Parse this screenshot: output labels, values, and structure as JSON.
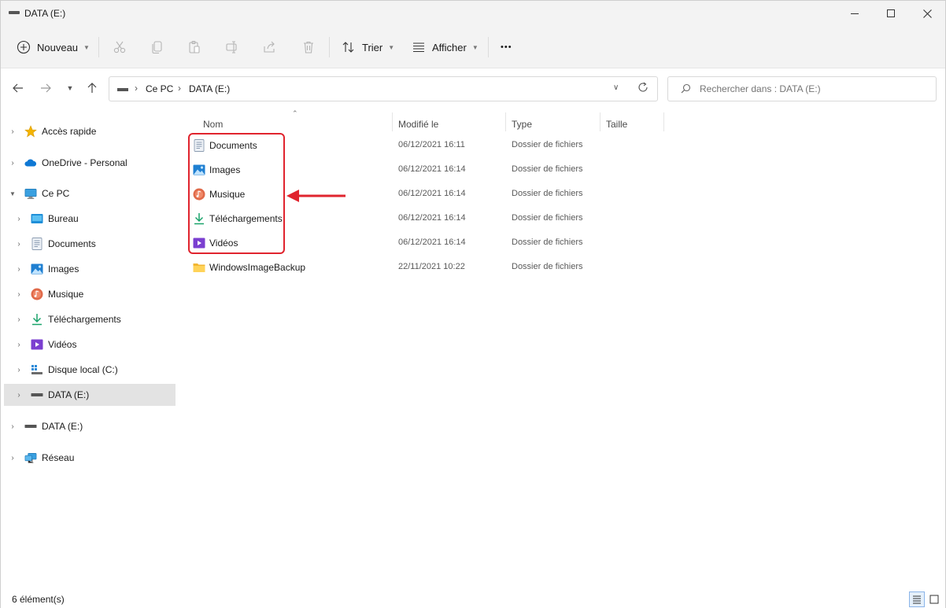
{
  "window": {
    "title": "DATA (E:)"
  },
  "toolbar": {
    "new_label": "Nouveau",
    "sort_label": "Trier",
    "view_label": "Afficher",
    "more_label": "•••"
  },
  "address": {
    "crumbs": [
      "Ce PC",
      "DATA (E:)"
    ]
  },
  "search": {
    "placeholder": "Rechercher dans : DATA (E:)"
  },
  "nav": {
    "items": [
      {
        "label": "Accès rapide",
        "icon": "star-icon"
      },
      {
        "label": "OneDrive - Personal",
        "icon": "cloud-icon"
      },
      {
        "label": "Ce PC",
        "icon": "computer-icon"
      },
      {
        "label": "Bureau",
        "icon": "desktop-icon"
      },
      {
        "label": "Documents",
        "icon": "document-icon"
      },
      {
        "label": "Images",
        "icon": "image-icon"
      },
      {
        "label": "Musique",
        "icon": "music-icon"
      },
      {
        "label": "Téléchargements",
        "icon": "download-icon"
      },
      {
        "label": "Vidéos",
        "icon": "video-icon"
      },
      {
        "label": "Disque local (C:)",
        "icon": "windows-drive-icon"
      },
      {
        "label": "DATA (E:)",
        "icon": "drive-icon"
      },
      {
        "label": "DATA (E:)",
        "icon": "drive-icon"
      },
      {
        "label": "Réseau",
        "icon": "network-icon"
      }
    ]
  },
  "columns": {
    "name": "Nom",
    "modified": "Modifié le",
    "type": "Type",
    "size": "Taille"
  },
  "files": [
    {
      "name": "Documents",
      "modified": "06/12/2021 16:11",
      "type": "Dossier de fichiers",
      "icon": "document-icon"
    },
    {
      "name": "Images",
      "modified": "06/12/2021 16:14",
      "type": "Dossier de fichiers",
      "icon": "image-icon"
    },
    {
      "name": "Musique",
      "modified": "06/12/2021 16:14",
      "type": "Dossier de fichiers",
      "icon": "music-icon"
    },
    {
      "name": "Téléchargements",
      "modified": "06/12/2021 16:14",
      "type": "Dossier de fichiers",
      "icon": "download-icon"
    },
    {
      "name": "Vidéos",
      "modified": "06/12/2021 16:14",
      "type": "Dossier de fichiers",
      "icon": "video-icon"
    },
    {
      "name": "WindowsImageBackup",
      "modified": "22/11/2021 10:22",
      "type": "Dossier de fichiers",
      "icon": "folder-icon"
    }
  ],
  "status": {
    "count": "6 élément(s)"
  },
  "colors": {
    "annotation": "#e0242e",
    "selected_bg": "#e3e3e3",
    "accent": "#0067c0"
  }
}
